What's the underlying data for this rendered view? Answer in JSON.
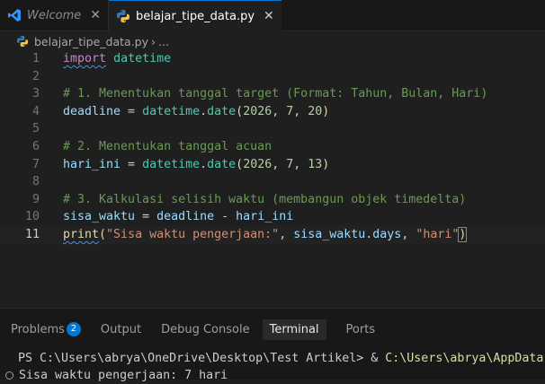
{
  "tabs": [
    {
      "label": "Welcome",
      "icon": "vscode-icon",
      "active": false
    },
    {
      "label": "belajar_tipe_data.py",
      "icon": "python-icon",
      "active": true
    }
  ],
  "breadcrumb": {
    "file": "belajar_tipe_data.py",
    "separator": "›",
    "more": "..."
  },
  "editor": {
    "line_numbers": [
      "1",
      "2",
      "3",
      "4",
      "5",
      "6",
      "7",
      "8",
      "9",
      "10",
      "11"
    ],
    "current_line": 11,
    "lines": {
      "l1": {
        "kw": "import",
        "mod": "datetime"
      },
      "l3": {
        "comment": "# 1. Menentukan tanggal target (Format: Tahun, Bulan, Hari)"
      },
      "l4": {
        "var": "deadline",
        "eq": " = ",
        "mod": "datetime",
        "dot": ".",
        "fn": "date",
        "open": "(",
        "a1": "2026",
        "c1": ", ",
        "a2": "7",
        "c2": ", ",
        "a3": "20",
        "close": ")"
      },
      "l6": {
        "comment": "# 2. Menentukan tanggal acuan"
      },
      "l7": {
        "var": "hari_ini",
        "eq": " = ",
        "mod": "datetime",
        "dot": ".",
        "fn": "date",
        "open": "(",
        "a1": "2026",
        "c1": ", ",
        "a2": "7",
        "c2": ", ",
        "a3": "13",
        "close": ")"
      },
      "l9": {
        "comment": "# 3. Kalkulasi selisih waktu (membangun objek timedelta)"
      },
      "l10": {
        "var": "sisa_waktu",
        "eq": " = ",
        "v2": "deadline",
        "minus": " - ",
        "v3": "hari_ini"
      },
      "l11": {
        "fn": "print",
        "open": "(",
        "s1": "\"Sisa waktu pengerjaan:\"",
        "c1": ", ",
        "v": "sisa_waktu",
        "dot": ".",
        "attr": "days",
        "c2": ", ",
        "s2": "\"hari\"",
        "close": ")"
      }
    }
  },
  "panel": {
    "tabs": [
      {
        "label": "Problems",
        "badge": "2"
      },
      {
        "label": "Output"
      },
      {
        "label": "Debug Console"
      },
      {
        "label": "Terminal",
        "active": true
      },
      {
        "label": "Ports"
      }
    ],
    "terminal": {
      "prompt": "PS C:\\Users\\abrya\\OneDrive\\Desktop\\Test Artikel> & ",
      "command_path": "C:\\Users\\abrya\\AppData",
      "output": "Sisa waktu pengerjaan: 7 hari"
    }
  },
  "colors": {
    "accent": "#0078d4",
    "background": "#1f1f1f"
  }
}
